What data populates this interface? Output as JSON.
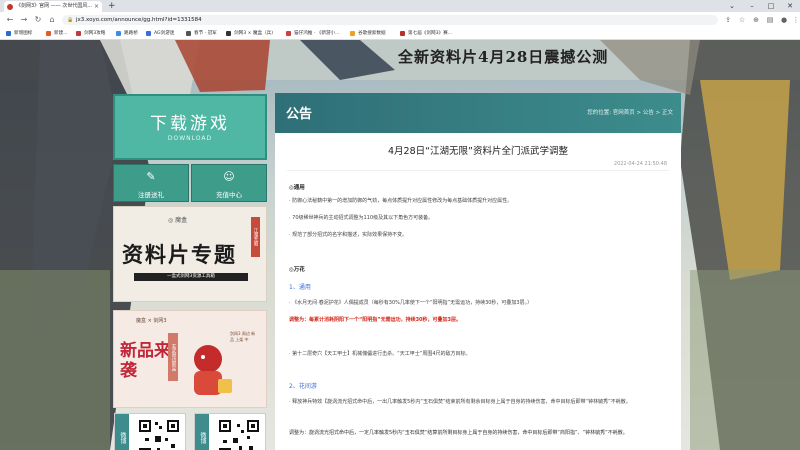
{
  "browser": {
    "tab_title": "《剑网3》官网 —— 次世代国风...",
    "url": "jx3.xoyo.com/announce/gg.html?id=1331584",
    "bookmarks": [
      "新增图标",
      "新建...",
      "剑网3攻略",
      "路路桥",
      "AG剑游迷",
      "春节 · 冠军",
      "剑网3 × 魔盒（兵)",
      "猫仔鸿推 · 《新游小...",
      "谷歌搜索数据",
      "第七届《剑网3》赛..."
    ]
  },
  "banner": {
    "title": "全新资料片4月28日震撼公测"
  },
  "sidebar": {
    "download": {
      "title": "下载游戏",
      "subtitle": "DOWNLOAD"
    },
    "buttons": [
      {
        "icon": "✎",
        "label": "注册送礼"
      },
      {
        "icon": "☺",
        "label": "充值中心"
      }
    ],
    "promo": {
      "tag": "◎ 魔盒",
      "title": "资料片专题",
      "subtitle": "一盒式剑网3资源工具箱",
      "badge": "江湖无限"
    },
    "newitem": {
      "logo": "魔盒 × 剑网3",
      "title": "新品来袭",
      "label": "玄武周边新品",
      "side": "剑网3 周边 新品 上架 中"
    },
    "qr_cards": [
      {
        "label": "微博"
      },
      {
        "label": "微博"
      }
    ]
  },
  "main": {
    "header": "公告",
    "breadcrumb": "您的位置: 官网首页 > 公告 > 正文",
    "article": {
      "title": "4月28日“江湖无限”资料片全门派武学调整",
      "date": "2022-04-24 21:50:48",
      "s1_heading": "◎通用",
      "s1_p1": "· 防御心法秘籍中第一的增加防御的气劲，每点体质提升对应属性修改为每点基础体质提升对应属性。",
      "s1_p2": "· 70级稀世神兵的主动招式调整为110级及其以下角色方可装备。",
      "s1_p3": "· 规范了部分招式的名字和描述，实际效果保持不变。",
      "s2_heading": "◎万花",
      "s2_sub1": "1、通用",
      "s2_p1": "· 《水月无间·春泥护花》人偶提成员（每秒有30%几率使下一个“阳明指”无需运功，持续30秒，可叠加3层。）",
      "s2_p2": "调整为：每累计消耗阴阳下一个“阳明指”无需运功，持续30秒，可叠加3层。",
      "s2_p3": "· 第十二层奇穴【天工甲士】机械傀儡进行击杀。“天工甲士”周围4尺的敌方目标。",
      "s2_sub2": "2、花间游",
      "s2_p4": "· 释放神兵特效【旋涡流光招式命中后，一出几率触发5秒内“玉石俱焚”结束前所有剩余目标身上属于自身的持续伤害，命中目标后即带“钟林毓秀”不耗散。",
      "s2_p5": "调整为：旋涡流光招式命中后，一定几率触发5秒内“玉石俱焚”结算前所剩目标身上属于自身的持续伤害，命中目标后即带“商阳指”、“钟林毓秀”不耗散。"
    }
  },
  "colors": {
    "teal": "#4fb7a3",
    "header_teal": "#2f6f77",
    "link_blue": "#3a6fd8",
    "emphasis_red": "#d6291b"
  }
}
